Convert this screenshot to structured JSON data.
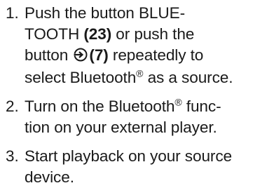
{
  "steps": [
    {
      "number": "1.",
      "line1": "Push the button BLUE-",
      "line2a": "TOOTH ",
      "ref1": "(23)",
      "line2b": " or push the",
      "line3a": "button ",
      "ref2": "(7)",
      "line3b": " repeatedly to",
      "line4a": "select Bluetooth",
      "reg": "®",
      "line4b": " as a source."
    },
    {
      "number": "2.",
      "line1a": "Turn on the Bluetooth",
      "reg": "®",
      "line1b": " func-",
      "line2": "tion on your external player."
    },
    {
      "number": "3.",
      "line1": "Start playback on your source",
      "line2": "device."
    }
  ],
  "icons": {
    "source_button": "source-input-icon"
  }
}
